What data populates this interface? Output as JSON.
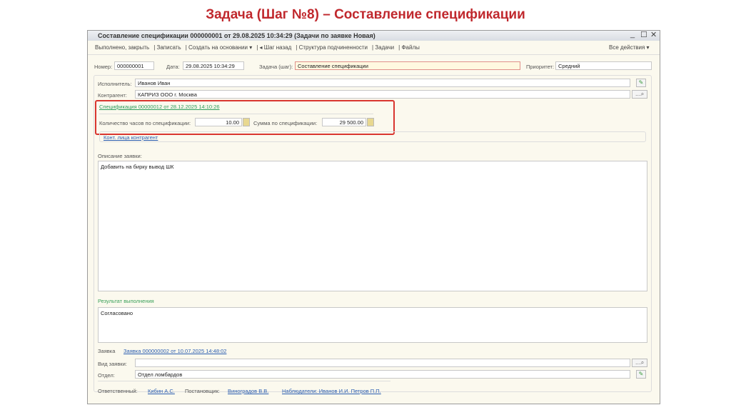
{
  "slide_title": "Задача (Шаг №8) – Составление спецификации",
  "window": {
    "title": "Составление спецификации 000000001 от 29.08.2025 10:34:29 (Задачи по заявке Новая)",
    "minimize": "_",
    "maximize": "☐",
    "close": "✕"
  },
  "toolbar": {
    "done_close": "Выполнено, закрыть",
    "save": "Записать",
    "create_based": "Создать на основании ▾",
    "step_back": "◂ Шаг назад",
    "structure": "Структура подчиненности",
    "tasks": "Задачи",
    "files": "Файлы",
    "all_actions": "Все действия ▾"
  },
  "header": {
    "number_label": "Номер:",
    "number": "000000001",
    "date_label": "Дата:",
    "date": "29.08.2025 10:34:29",
    "task_label": "Задача (шаг):",
    "task": "Составление спецификации",
    "priority_label": "Приоритет:",
    "priority": "Средний"
  },
  "form": {
    "executor_label": "Исполнитель:",
    "executor": "Иванов Иван",
    "contractor_label": "Контрагент:",
    "contractor": "КАПРИЗ ООО г. Москва",
    "spec_link": "Спецификация 00000012 от 28.12.2025 14:10:26",
    "hours_label": "Количество часов по спецификации:",
    "hours": "10.00",
    "sum_label": "Сумма по спецификации:",
    "sum": "29 500.00",
    "contacts_link": "Конт. лица контрагент",
    "desc_label": "Описание заявки:",
    "desc": "Добавить на бирку вывод ШК",
    "result_label": "Результат выполнения",
    "result": "Согласовано",
    "request_label": "Заявка",
    "request_link": "Заявка 000000002 от 10.07.2025 14:48:02",
    "request_type_label": "Вид заявки:",
    "request_type": "",
    "dept_label": "Отдел:",
    "dept": "Отдел ломбардов",
    "responsible_label": "Ответственный:",
    "responsible": "Кибин А.С.",
    "setter_label": "Постановщик:",
    "setter": "Виноградов В.В.",
    "observers": "Наблюдатели: Иванов И.И. Петров П.П."
  }
}
